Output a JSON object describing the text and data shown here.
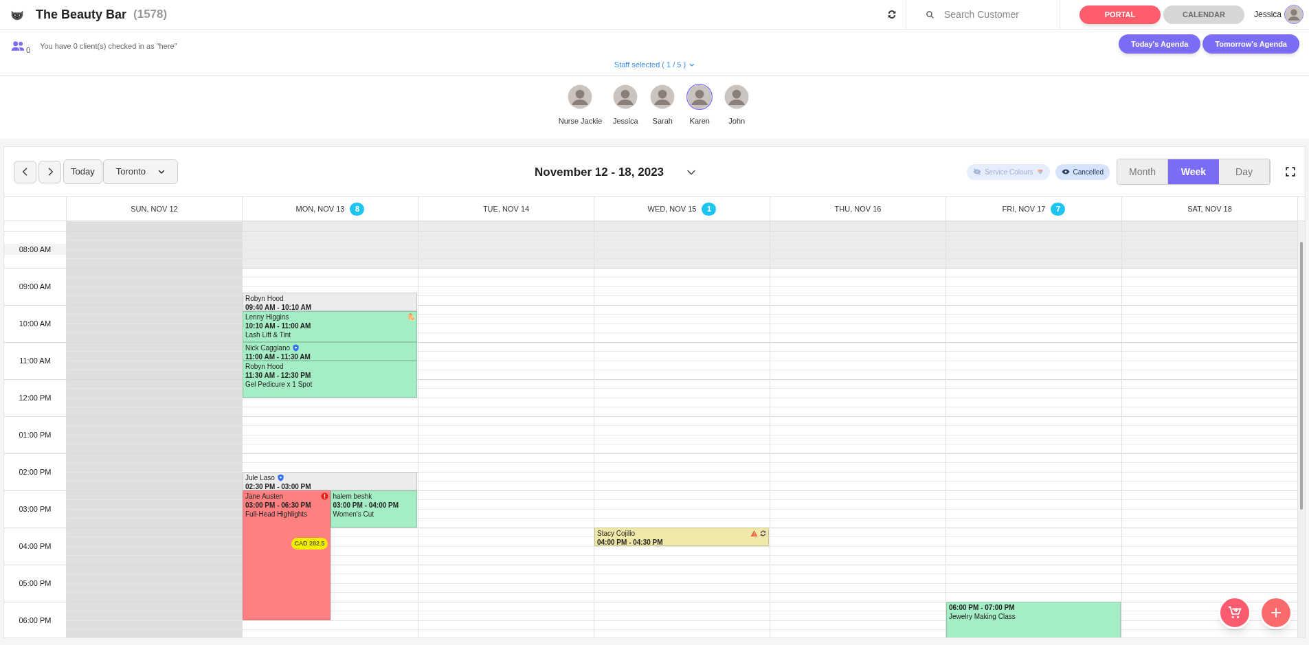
{
  "header": {
    "title": "The Beauty Bar",
    "count": "(1578)",
    "search": {
      "placeholder": "Search Customer"
    },
    "nav": [
      {
        "label": "PORTAL",
        "selected": true
      },
      {
        "label": "CALENDAR",
        "selected": false
      }
    ],
    "user": "Jessica"
  },
  "checkin": {
    "count": "0",
    "message": "You have 0 client(s) checked in as \"here\"",
    "buttons": [
      "Today's Agenda",
      "Tomorrow's Agenda"
    ]
  },
  "staff_selected": "Staff selected ( 1 / 5 )",
  "staff": [
    {
      "name": "Nurse Jackie",
      "selected": false
    },
    {
      "name": "Jessica",
      "selected": false
    },
    {
      "name": "Sarah",
      "selected": false
    },
    {
      "name": "Karen",
      "selected": true
    },
    {
      "name": "John",
      "selected": false
    }
  ],
  "calendar": {
    "today_button": "Today",
    "location": "Toronto",
    "range": "November 12 - 18, 2023",
    "filters": [
      {
        "label": "Service Colours",
        "on": false
      },
      {
        "label": "Cancelled",
        "on": true
      }
    ],
    "views": [
      {
        "label": "Month",
        "selected": false
      },
      {
        "label": "Week",
        "selected": true
      },
      {
        "label": "Day",
        "selected": false
      }
    ],
    "hours": [
      {
        "label": "08:00 AM",
        "closed": true
      },
      {
        "label": "09:00 AM",
        "closed": false
      },
      {
        "label": "10:00 AM",
        "closed": false
      },
      {
        "label": "11:00 AM",
        "closed": false
      },
      {
        "label": "12:00 PM",
        "closed": false
      },
      {
        "label": "01:00 PM",
        "closed": false
      },
      {
        "label": "02:00 PM",
        "closed": false
      },
      {
        "label": "03:00 PM",
        "closed": false
      },
      {
        "label": "04:00 PM",
        "closed": false
      },
      {
        "label": "05:00 PM",
        "closed": false
      },
      {
        "label": "06:00 PM",
        "closed": false
      }
    ],
    "days": [
      {
        "label": "SUN, NOV 12",
        "closed": true
      },
      {
        "label": "MON, NOV 13",
        "count": "8",
        "closed": false,
        "events": [
          {
            "name": "Robyn Hood",
            "time": "09:40 AM - 10:10 AM",
            "color": "#ececec"
          },
          {
            "name": "Lenny Higgins",
            "time": "10:10 AM - 11:00 AM",
            "service": "Lash Lift & Tint",
            "color": "#a5edc4",
            "note": true
          },
          {
            "name": "Nick Caggiano",
            "time": "11:00 AM - 11:30 AM",
            "color": "#a5edc4",
            "verified": true
          },
          {
            "name": "Robyn Hood",
            "time": "11:30 AM - 12:30 PM",
            "service": "Gel Pedicure x 1 Spot",
            "color": "#a5edc4"
          },
          {
            "name": "Jule Laso",
            "time": "02:30 PM - 03:00 PM",
            "color": "#ececec",
            "verified": true
          },
          {
            "name": "Jane Austen",
            "time": "03:00 PM - 06:30 PM",
            "service": "Full-Head Highlights",
            "color": "#ff8080",
            "alert": true,
            "price": "CAD 282.5"
          },
          {
            "name": "halem beshk",
            "time": "03:00 PM - 04:00 PM",
            "service": "Women's Cut",
            "color": "#a5edc4"
          }
        ]
      },
      {
        "label": "TUE, NOV 14",
        "closed": false
      },
      {
        "label": "WED, NOV 15",
        "count": "1",
        "closed": false,
        "events": [
          {
            "name": "Stacy Cojilio",
            "time": "04:00 PM - 04:30 PM",
            "color": "#efe8a8",
            "warning": true,
            "recurring": true
          }
        ]
      },
      {
        "label": "THU, NOV 16",
        "closed": false
      },
      {
        "label": "FRI, NOV 17",
        "count": "7",
        "closed": false,
        "events": [
          {
            "time": "06:00 PM - 07:00 PM",
            "service": "Jewelry Making Class",
            "color": "#a5edc4"
          }
        ]
      },
      {
        "label": "SAT, NOV 18",
        "closed": false
      }
    ]
  }
}
